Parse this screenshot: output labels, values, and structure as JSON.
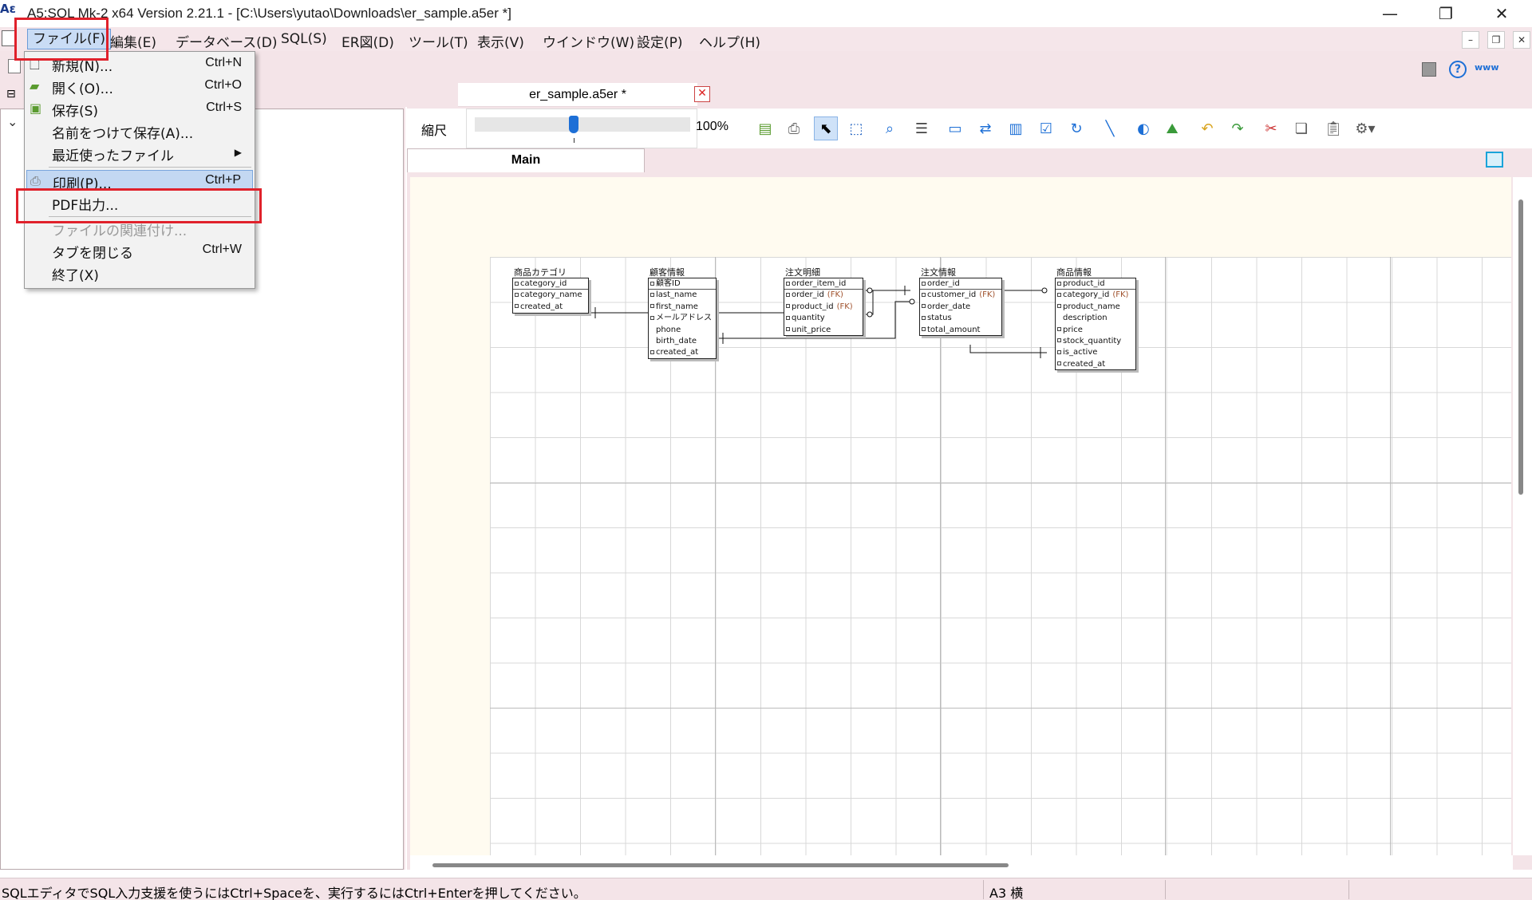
{
  "window": {
    "title": "A5:SQL Mk-2 x64 Version 2.21.1 - [C:\\Users\\yutao\\Downloads\\er_sample.a5er *]",
    "minimize_glyph": "—",
    "restore_glyph": "❐",
    "close_glyph": "✕"
  },
  "menubar": {
    "items": [
      "ファイル(F)",
      "編集(E)",
      "データベース(D)",
      "SQL(S)",
      "ER図(D)",
      "ツール(T)",
      "表示(V)",
      "ウインドウ(W)",
      "設定(P)",
      "ヘルプ(H)"
    ]
  },
  "file_menu": {
    "items": [
      {
        "label": "新規(N)...",
        "shortcut": "Ctrl+N",
        "icon": "new-file-icon"
      },
      {
        "label": "開く(O)...",
        "shortcut": "Ctrl+O",
        "icon": "open-folder-icon"
      },
      {
        "label": "保存(S)",
        "shortcut": "Ctrl+S",
        "icon": "save-icon"
      },
      {
        "label": "名前をつけて保存(A)...",
        "shortcut": "",
        "icon": ""
      },
      {
        "label": "最近使ったファイル",
        "shortcut": "▶",
        "icon": ""
      },
      {
        "label": "印刷(P)...",
        "shortcut": "Ctrl+P",
        "icon": "print-icon"
      },
      {
        "label": "PDF出力...",
        "shortcut": "",
        "icon": ""
      },
      {
        "label": "ファイルの関連付け...",
        "shortcut": "",
        "icon": ""
      },
      {
        "label": "タブを閉じる",
        "shortcut": "Ctrl+W",
        "icon": ""
      },
      {
        "label": "終了(X)",
        "shortcut": "",
        "icon": ""
      }
    ]
  },
  "document": {
    "tab_title": "er_sample.a5er *",
    "zoom_label": "縮尺",
    "zoom_value": "100%",
    "zoom_level_percent": 100,
    "sheet_tab": "Main"
  },
  "entities": [
    {
      "title": "商品カテゴリ",
      "attrs": [
        {
          "name": "category_id"
        },
        {
          "name": "category_name"
        },
        {
          "name": "created_at"
        }
      ]
    },
    {
      "title": "顧客情報",
      "attrs": [
        {
          "name": "顧客ID"
        },
        {
          "name": "last_name"
        },
        {
          "name": "first_name"
        },
        {
          "name": "メールアドレス"
        },
        {
          "name": "phone"
        },
        {
          "name": "birth_date"
        },
        {
          "name": "created_at"
        }
      ]
    },
    {
      "title": "注文明細",
      "attrs": [
        {
          "name": "order_item_id"
        },
        {
          "name": "order_id",
          "fk": "(FK)"
        },
        {
          "name": "product_id",
          "fk": "(FK)"
        },
        {
          "name": "quantity"
        },
        {
          "name": "unit_price"
        }
      ]
    },
    {
      "title": "注文情報",
      "attrs": [
        {
          "name": "order_id"
        },
        {
          "name": "customer_id",
          "fk": "(FK)"
        },
        {
          "name": "order_date"
        },
        {
          "name": "status"
        },
        {
          "name": "total_amount"
        }
      ]
    },
    {
      "title": "商品情報",
      "attrs": [
        {
          "name": "product_id"
        },
        {
          "name": "category_id",
          "fk": "(FK)"
        },
        {
          "name": "product_name"
        },
        {
          "name": "description"
        },
        {
          "name": "price"
        },
        {
          "name": "stock_quantity"
        },
        {
          "name": "is_active"
        },
        {
          "name": "created_at"
        }
      ]
    }
  ],
  "statusbar": {
    "message": "SQLエディタでSQL入力支援を使うにはCtrl+Spaceを、実行するにはCtrl+Enterを押してください。",
    "paper": "A3 横"
  },
  "colors": {
    "menubar_bg": "#f5e6ea",
    "highlight_box": "#e0212b",
    "menu_highlight": "#c3d8f2",
    "fk_text": "#a0522d"
  }
}
